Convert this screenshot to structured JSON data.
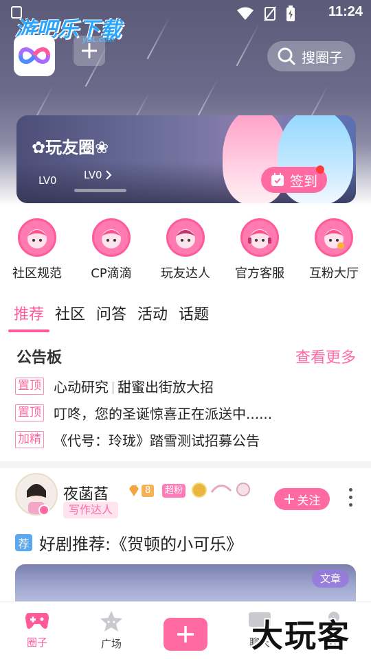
{
  "status_bar": {
    "time": "11:24"
  },
  "watermark_top": {
    "title": "游吧乐下载",
    "sub": "yBL.com"
  },
  "header": {
    "search_label": "搜圈子"
  },
  "banner": {
    "circle_name": "✿玩友圈❀",
    "level_current": "LV0",
    "level_next": "LV0",
    "signin_label": "签到"
  },
  "categories": [
    {
      "label": "社区规范",
      "icon": "character-avatar-icon"
    },
    {
      "label": "CP滴滴",
      "icon": "character-avatar-icon"
    },
    {
      "label": "玩友达人",
      "icon": "character-avatar-icon"
    },
    {
      "label": "官方客服",
      "icon": "character-avatar-icon"
    },
    {
      "label": "互粉大厅",
      "icon": "character-avatar-icon"
    }
  ],
  "tabs": [
    {
      "label": "推荐",
      "active": true
    },
    {
      "label": "社区",
      "active": false
    },
    {
      "label": "问答",
      "active": false
    },
    {
      "label": "活动",
      "active": false
    },
    {
      "label": "话题",
      "active": false
    }
  ],
  "board": {
    "title": "公告板",
    "more": "查看更多",
    "items": [
      {
        "tag": "置顶",
        "text_a": "心动研究",
        "text_b": "甜蜜出街放大招"
      },
      {
        "tag": "置顶",
        "text": "叮咚，您的圣诞惊喜正在派送中......"
      },
      {
        "tag": "加精",
        "text": "《代号：玲珑》踏雪测试招募公告"
      }
    ]
  },
  "post": {
    "author": "夜菡萏",
    "author_tag": "写作达人",
    "level": "8",
    "super_fan": "超粉",
    "follow_label": "关注",
    "title_tag": "荐",
    "title": "好剧推荐:《贺顿的小可乐》",
    "article_tag": "文章"
  },
  "bottom_nav": [
    {
      "label": "圈子",
      "active": true
    },
    {
      "label": "广场",
      "active": false
    },
    {
      "label": "",
      "active": false
    },
    {
      "label": "聊天",
      "active": false
    },
    {
      "label": "我的",
      "active": false
    }
  ],
  "watermark_bottom": "大玩客",
  "colors": {
    "accent": "#ff6aa2",
    "tag_blue": "#5aa8f0"
  }
}
